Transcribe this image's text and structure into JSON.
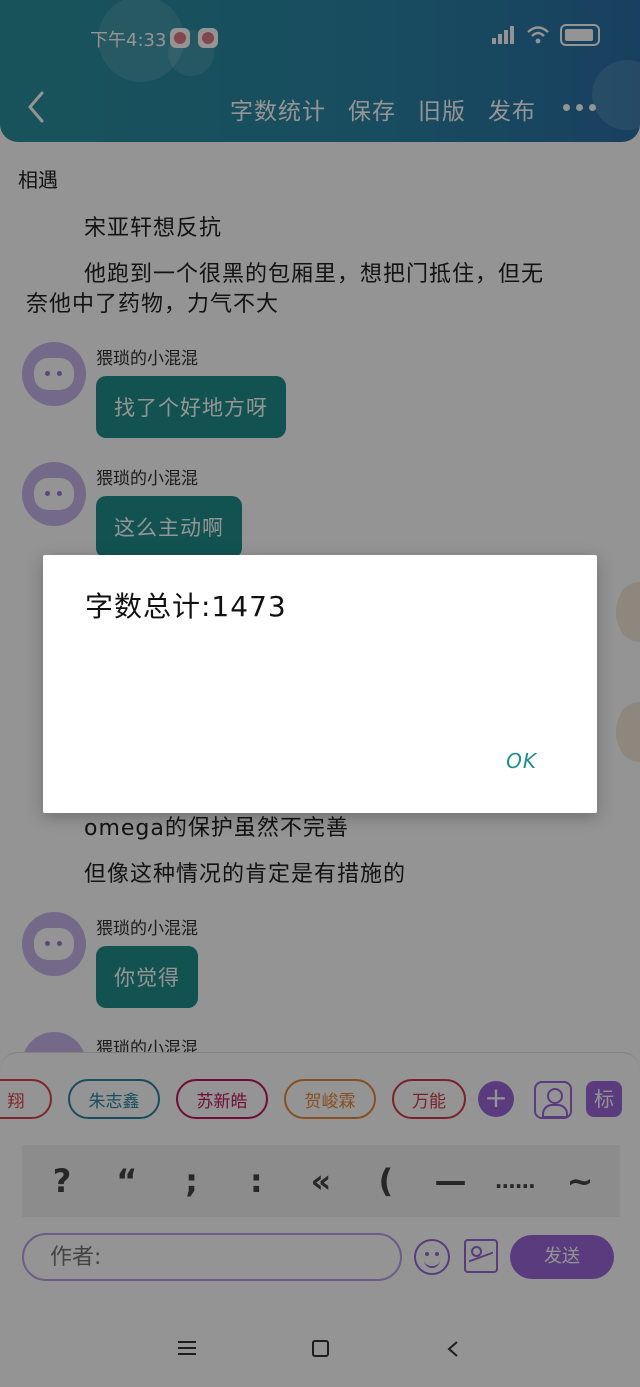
{
  "status_bar": {
    "time": "下午4:33"
  },
  "header": {
    "actions": [
      "字数统计",
      "保存",
      "旧版",
      "发布"
    ]
  },
  "content": {
    "chapter_title": "相遇",
    "para1": "宋亚轩想反抗",
    "para2_line1": "他跑到一个很黑的包厢里，想把门抵住，但无",
    "para2_line2": "奈他中了药物，力气不大",
    "messages": [
      {
        "name": "猥琐的小混混",
        "text": "找了个好地方呀"
      },
      {
        "name": "猥琐的小混混",
        "text": "这么主动啊"
      },
      {
        "name": "猥琐的小混混",
        "text": "你觉得"
      },
      {
        "name": "猥琐的小混混"
      }
    ],
    "para3": "omega的保护虽然不完善",
    "para4": "但像这种情况的肯定是有措施的"
  },
  "toolbar": {
    "chips": [
      {
        "label": "翔",
        "color": "#e0404a"
      },
      {
        "label": "朱志鑫",
        "color": "#2a86a6"
      },
      {
        "label": "苏新皓",
        "color": "#c2185b"
      },
      {
        "label": "贺峻霖",
        "color": "#e8893a"
      },
      {
        "label": "万能",
        "color": "#d33a4a"
      }
    ],
    "plus_label": "+",
    "tag_label": "标",
    "punctuation": [
      "?",
      "“",
      ";",
      ":",
      "«",
      "(",
      "—",
      "……",
      "~"
    ],
    "author_placeholder": "作者:",
    "send_label": "发送"
  },
  "dialog": {
    "message": "字数总计:1473",
    "ok_label": "OK"
  },
  "colors": {
    "header": "#2a86a6",
    "accent": "#9b67d9",
    "bubble": "#1f8f8d"
  }
}
